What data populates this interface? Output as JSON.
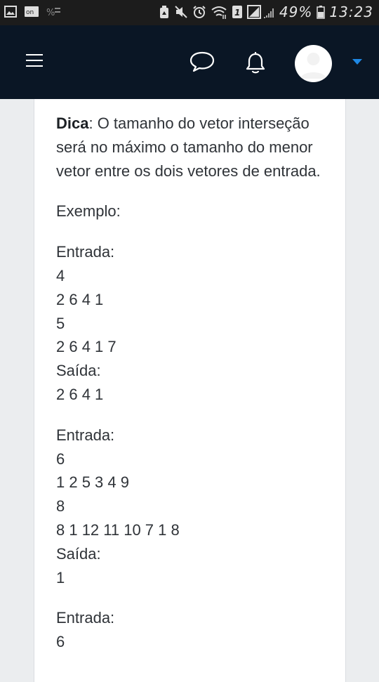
{
  "status_bar": {
    "battery": "49%",
    "time": "13:23",
    "sim_slot": "1",
    "icons": [
      "image-icon",
      "cast-icon",
      "wifi-calling-icon",
      "recycle-icon",
      "mute-icon",
      "alarm-icon",
      "wifi-icon",
      "sim-icon",
      "signal-icon",
      "battery-icon"
    ]
  },
  "navbar": {
    "icons": [
      "menu-icon",
      "chat-icon",
      "bell-icon",
      "avatar",
      "caret-down-icon"
    ],
    "accent_color": "#1e88e5",
    "background": "#0a1625"
  },
  "content": {
    "tip_label": "Dica",
    "tip_text": ": O tamanho do vetor interseção será no máximo o tamanho do menor vetor entre os dois vetores de entrada.",
    "example_label": "Exemplo:",
    "examples": [
      {
        "input_label": "Entrada:",
        "n1": "4",
        "v1": "2 6 4 1",
        "n2": "5",
        "v2": "2 6 4 1 7",
        "output_label": "Saída:",
        "output": "2 6 4 1"
      },
      {
        "input_label": "Entrada:",
        "n1": "6",
        "v1": "1 2 5 3 4 9",
        "n2": "8",
        "v2": "8 1 12 11 10 7 1 8",
        "output_label": "Saída:",
        "output": "1"
      },
      {
        "input_label": "Entrada:",
        "n1": "6"
      }
    ]
  }
}
